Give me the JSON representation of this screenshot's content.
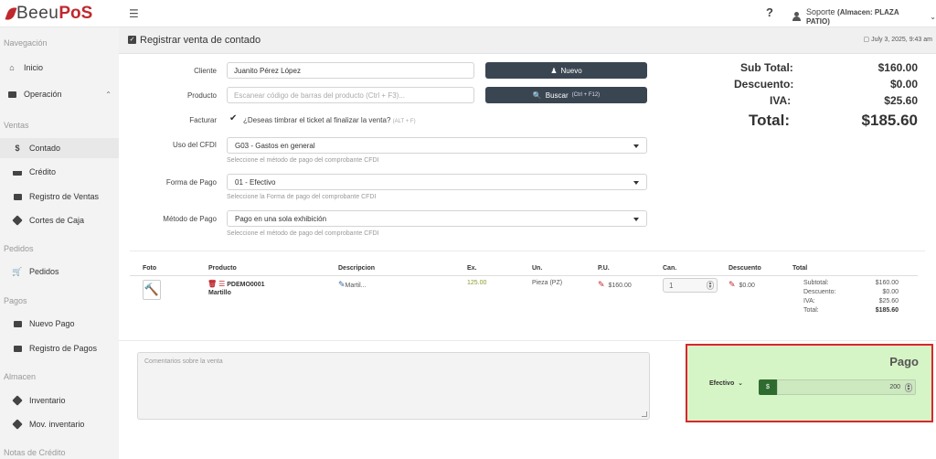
{
  "app": {
    "brand_part1": "Beeu",
    "brand_part2": "PoS",
    "help_label": "?",
    "user_label": "Soporte",
    "warehouse_label": "(Almacen: PLAZA PATIO)"
  },
  "sidebar": {
    "sec_navegacion": "Navegación",
    "inicio": "Inicio",
    "operacion": "Operación",
    "sec_ventas": "Ventas",
    "contado": "Contado",
    "credito": "Crédito",
    "registro_ventas": "Registro de Ventas",
    "cortes_caja": "Cortes de Caja",
    "sec_pedidos": "Pedidos",
    "pedidos": "Pedidos",
    "sec_pagos": "Pagos",
    "nuevo_pago": "Nuevo Pago",
    "registro_pagos": "Registro de Pagos",
    "sec_almacen": "Almacen",
    "inventario": "Inventario",
    "mov_inventario": "Mov. inventario",
    "sec_notas": "Notas de Crédito"
  },
  "page": {
    "title": "Registrar venta de contado",
    "date": "July 3, 2025, 9:43 am"
  },
  "form": {
    "cliente_label": "Cliente",
    "cliente_value": "Juanito Pérez López",
    "nuevo_button": "Nuevo",
    "producto_label": "Producto",
    "producto_placeholder": "Escanear código de barras del producto (Ctrl + F3)...",
    "buscar_button": "Buscar",
    "buscar_hint": "(Ctrl + F12)",
    "facturar_label": "Facturar",
    "facturar_text": "¿Deseas timbrar el ticket al finalizar la venta?",
    "facturar_hint": "(ALT + F)",
    "uso_label": "Uso del CFDI",
    "uso_value": "G03 - Gastos en general",
    "uso_hint": "Seleccione el método de pago del comprobante CFDI",
    "forma_label": "Forma de Pago",
    "forma_value": "01 - Efectivo",
    "forma_hint": "Seleccione la Forma de pago del comprobante CFDI",
    "metodo_label": "Método de Pago",
    "metodo_value": "Pago en una sola exhibición",
    "metodo_hint": "Seleccione el método de pago del comprobante CFDI"
  },
  "totals": {
    "subtotal_label": "Sub Total:",
    "subtotal_value": "$160.00",
    "descuento_label": "Descuento:",
    "descuento_value": "$0.00",
    "iva_label": "IVA:",
    "iva_value": "$25.60",
    "total_label": "Total:",
    "total_value": "$185.60"
  },
  "table": {
    "headers": [
      "Foto",
      "Producto",
      "Descripcion",
      "Ex.",
      "Un.",
      "P.U.",
      "Can.",
      "Descuento",
      "Total"
    ],
    "row": {
      "code": "PDEMO0001",
      "name": "Martillo",
      "description": "Martil...",
      "stock": "125.00",
      "unit": "Pieza (PZ)",
      "price": "$160.00",
      "quantity": "1",
      "discount": "$0.00",
      "subtotal_label": "Subtotal:",
      "subtotal_value": "$160.00",
      "descuento_label": "Descuento:",
      "descuento_value": "$0.00",
      "iva_label": "IVA:",
      "iva_value": "$25.60",
      "total_label": "Total:",
      "total_value": "$185.60"
    }
  },
  "comments": {
    "placeholder": "Comentarios sobre la venta"
  },
  "pago": {
    "title": "Pago",
    "method": "Efectivo",
    "currency": "$",
    "amount": "200"
  }
}
